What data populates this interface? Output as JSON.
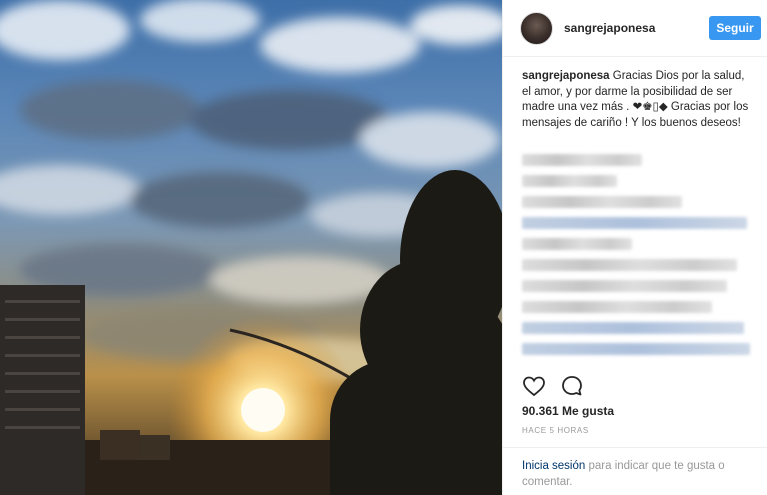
{
  "post": {
    "username": "sangrejaponesa",
    "follow_label": "Seguir",
    "caption_username": "sangrejaponesa",
    "caption_text": "Gracias Dios por la salud, el amor, y por darme la posibilidad de ser madre una vez más . ❤♚▯◆ Gracias por los mensajes de cariño ! Y los buenos deseos!",
    "likes": "90.361 Me gusta",
    "time_ago": "HACE 5 HORAS"
  },
  "footer": {
    "login_link": "Inicia sesión",
    "login_text": " para indicar que te gusta o comentar."
  },
  "icons": {
    "like": "heart-icon",
    "comment": "comment-icon"
  },
  "colors": {
    "follow_button": "#3897f0",
    "link": "#003569"
  }
}
